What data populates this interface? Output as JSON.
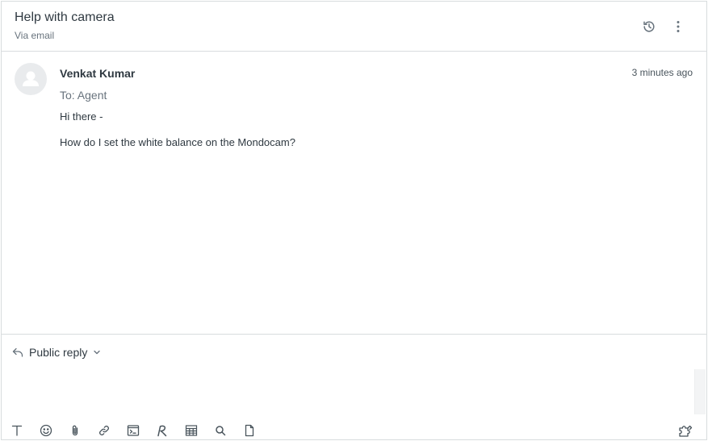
{
  "ticket": {
    "title": "Help with camera",
    "channel": "Via email"
  },
  "header_actions": {
    "history_icon": "history-icon",
    "more_icon": "more-vertical-icon"
  },
  "message": {
    "sender": "Venkat Kumar",
    "timestamp": "3 minutes ago",
    "recipient": "To: Agent",
    "body": [
      "Hi there -",
      "How do I set the white balance on the Mondocam?"
    ]
  },
  "composer": {
    "reply_type": "Public reply",
    "reply_icon": "reply-arrow-icon",
    "dropdown_icon": "chevron-down-icon",
    "value": ""
  },
  "toolbar": {
    "items": [
      "text-format-icon",
      "emoji-icon",
      "attachment-icon",
      "link-icon",
      "code-block-icon",
      "signature-icon",
      "table-icon",
      "search-icon",
      "document-icon"
    ],
    "right_item": "extension-puzzle-icon"
  },
  "colors": {
    "text": "#2f3941",
    "muted": "#68737d",
    "border": "#d8dcde",
    "avatar_bg": "#e9ebed"
  }
}
